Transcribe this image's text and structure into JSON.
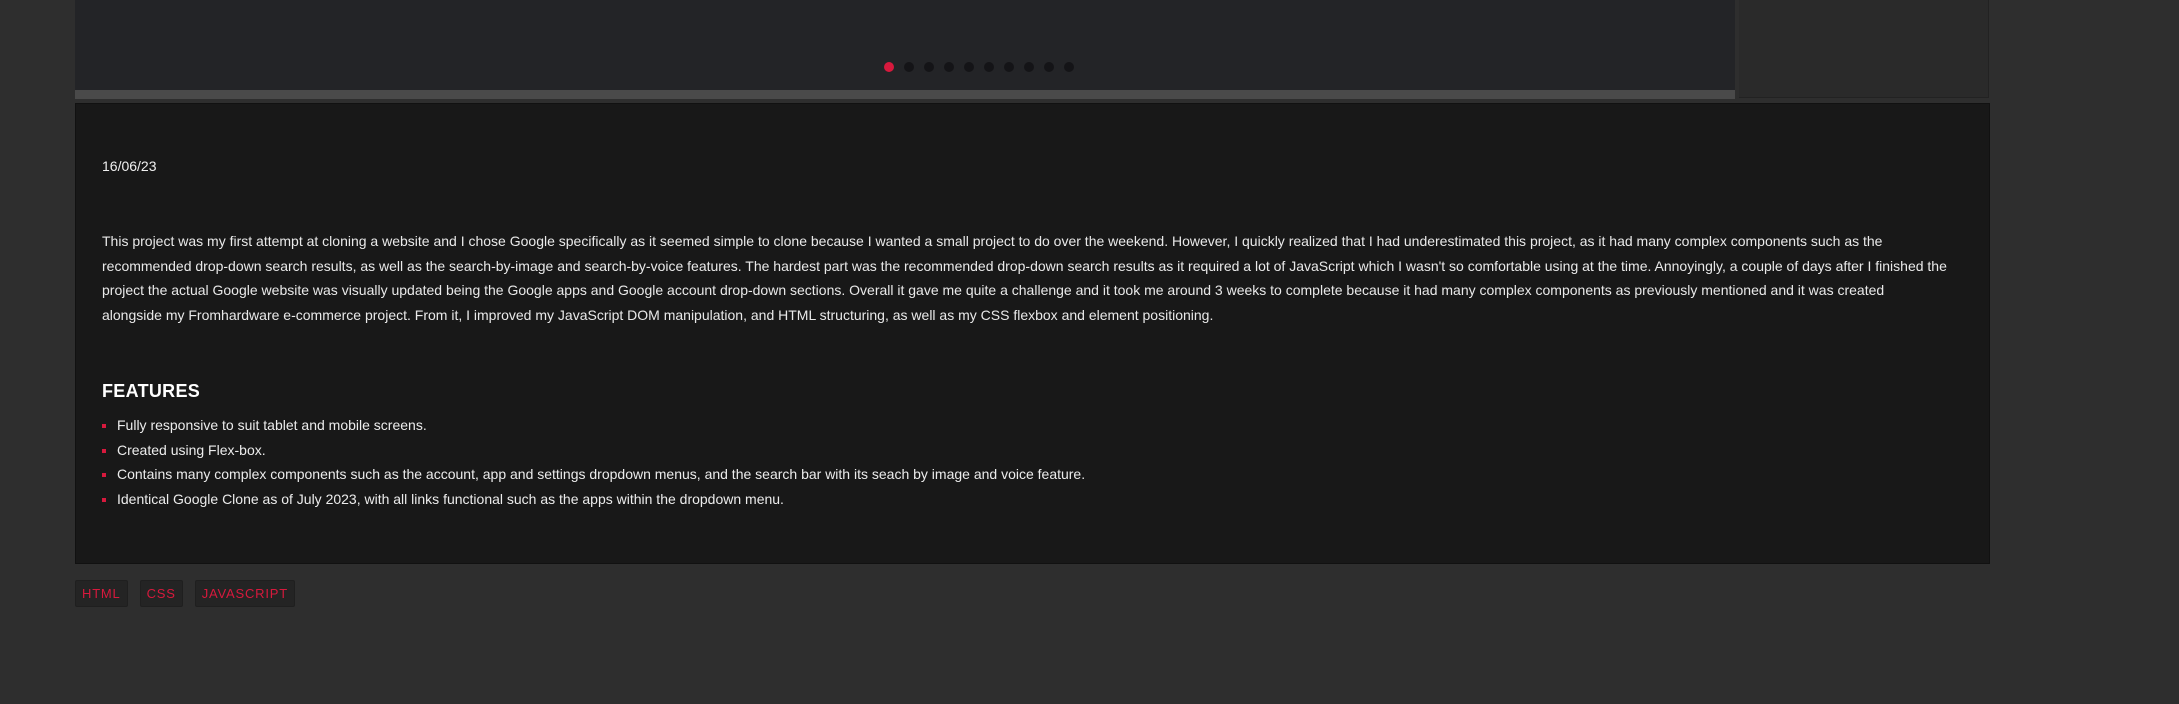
{
  "carousel": {
    "dot_count": 10,
    "active_index": 0,
    "accent_color": "#d7193d"
  },
  "project": {
    "date": "16/06/23",
    "description": "This project was my first attempt at cloning a website and I chose Google specifically as it seemed simple to clone because I wanted a small project to do over the weekend. However, I quickly realized that I had underestimated this project, as it had many complex components such as the recommended drop-down search results, as well as the search-by-image and search-by-voice features. The hardest part was the recommended drop-down search results as it required a lot of JavaScript which I wasn't so comfortable using at the time. Annoyingly, a couple of days after I finished the project the actual Google website was visually updated being the Google apps and Google account drop-down sections. Overall it gave me quite a challenge and it took me around 3 weeks to complete because it had many complex components as previously mentioned and it was created alongside my Fromhardware e-commerce project. From it, I improved my JavaScript DOM manipulation, and HTML structuring, as well as my CSS flexbox and element positioning.",
    "features_title": "FEATURES",
    "features": [
      "Fully responsive to suit tablet and mobile screens.",
      "Created using Flex-box.",
      "Contains many complex components such as the account, app and settings dropdown menus, and the search bar with its seach by image and voice feature.",
      "Identical Google Clone as of July 2023, with all links functional such as the apps within the dropdown menu."
    ]
  },
  "tags": [
    "HTML",
    "CSS",
    "JAVASCRIPT"
  ]
}
